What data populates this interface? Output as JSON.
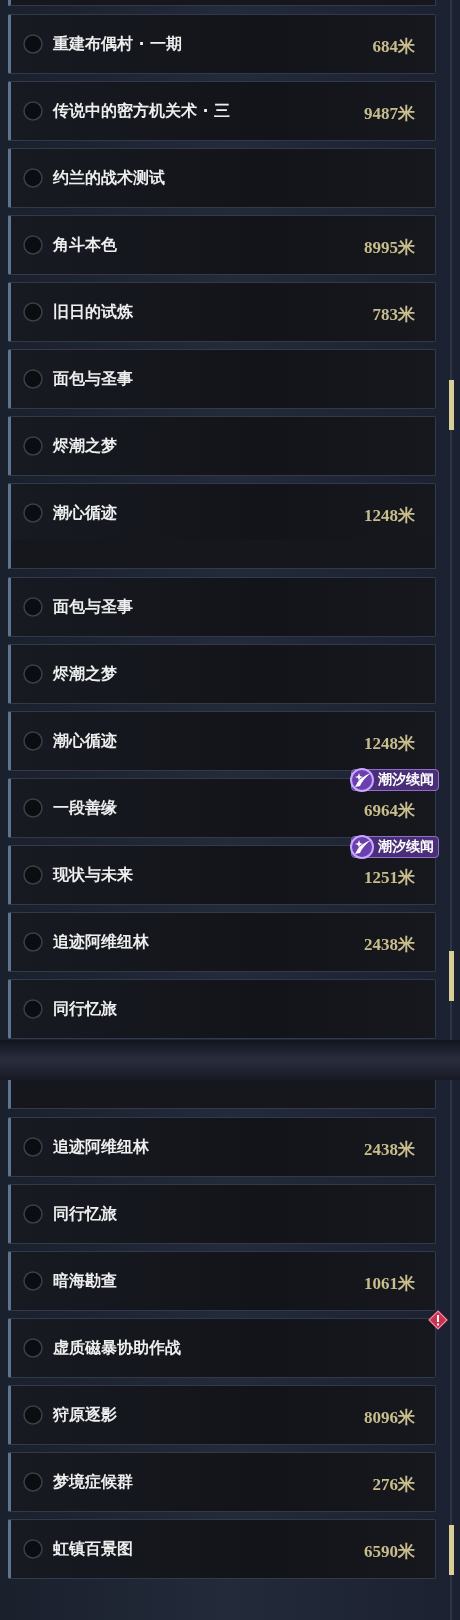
{
  "segments": [
    {
      "rows": [
        {
          "title": "重建布偶村 · 一期",
          "distance": "684米",
          "alert": false
        },
        {
          "title": "传说中的密方机关术 · 三",
          "distance": "9487米",
          "alert": false
        },
        {
          "title": "约兰的战术测试",
          "alert": false
        },
        {
          "title": "角斗本色",
          "distance": "8995米",
          "alert": false
        },
        {
          "title": "旧日的试炼",
          "distance": "783米",
          "alert": false
        },
        {
          "title": "面包与圣事",
          "alert": false
        },
        {
          "title": "烬潮之梦",
          "alert": false
        },
        {
          "title": "潮心循迹",
          "distance": "1248米",
          "alert": false
        }
      ]
    },
    {
      "rows": [
        {
          "title": "面包与圣事",
          "alert": false
        },
        {
          "title": "烬潮之梦",
          "alert": false
        },
        {
          "title": "潮心循迹",
          "distance": "1248米",
          "alert": false
        },
        {
          "title": "一段善缘",
          "distance": "6964米",
          "badge": "潮汐续闻",
          "alert": false
        },
        {
          "title": "现状与未来",
          "distance": "1251米",
          "badge": "潮汐续闻",
          "alert": false
        },
        {
          "title": "追迹阿维纽林",
          "distance": "2438米",
          "alert": false
        },
        {
          "title": "同行忆旅",
          "alert": false
        }
      ]
    },
    {
      "rows": [
        {
          "title": "追迹阿维纽林",
          "distance": "2438米",
          "alert": false
        },
        {
          "title": "同行忆旅",
          "alert": false
        },
        {
          "title": "暗海勘查",
          "distance": "1061米",
          "alert": false
        },
        {
          "title": "虚质磁暴协助作战",
          "alert": true
        },
        {
          "title": "狩原逐影",
          "distance": "8096米",
          "alert": false
        },
        {
          "title": "梦境症候群",
          "distance": "276米",
          "alert": false
        },
        {
          "title": "虹镇百景图",
          "distance": "6590米",
          "alert": false
        }
      ]
    }
  ]
}
